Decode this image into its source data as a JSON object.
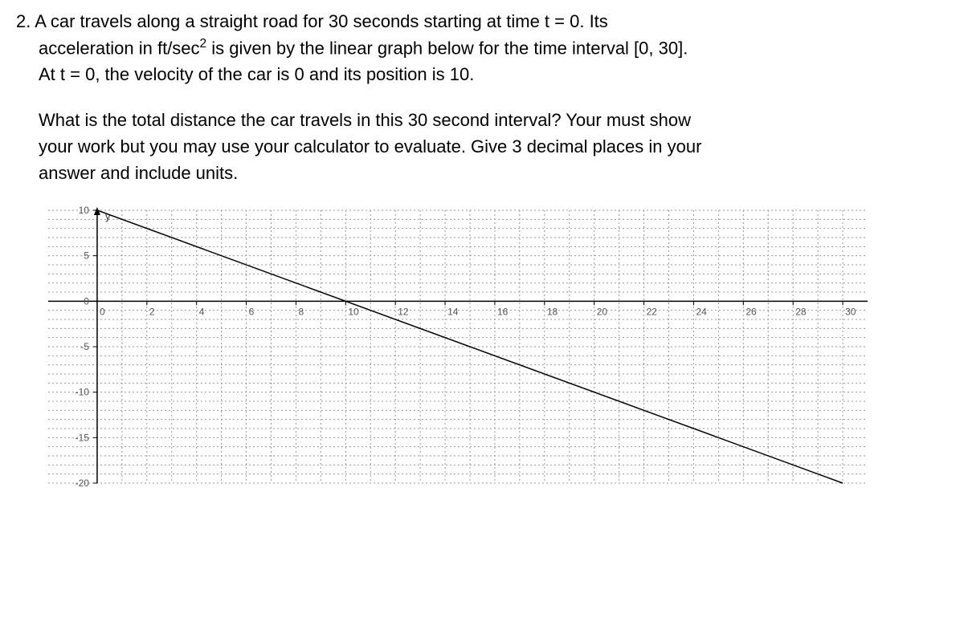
{
  "problem": {
    "number": "2.",
    "text_line1": "A car travels along a straight road for 30 seconds starting at time t = 0. Its",
    "text_line2_pre": "acceleration in ft/sec",
    "text_line2_sup": "2",
    "text_line2_post": " is given by the linear graph below for the time interval [0, 30].",
    "text_line3": "At t = 0, the velocity of the car is 0 and its position is 10.",
    "question_line1": "What is the total distance the car travels in this 30 second interval? Your must show",
    "question_line2": "your work but you may use your calculator to evaluate. Give 3 decimal places in your",
    "question_line3": "answer and include units."
  },
  "chart_data": {
    "type": "line",
    "title": "",
    "xlabel": "",
    "ylabel": "y",
    "xlim": [
      -1,
      31
    ],
    "ylim": [
      -20,
      10
    ],
    "x_ticks": [
      0,
      2,
      4,
      6,
      8,
      10,
      12,
      14,
      16,
      18,
      20,
      22,
      24,
      26,
      28,
      30
    ],
    "y_ticks": [
      -20,
      -15,
      -10,
      -5,
      0,
      5,
      10
    ],
    "x_tick_labels": [
      "0",
      "2",
      "4",
      "6",
      "8",
      "10",
      "12",
      "14",
      "16",
      "18",
      "20",
      "22",
      "24",
      "26",
      "28",
      "30"
    ],
    "y_tick_labels": [
      "-20",
      "-15",
      "-10",
      "-5",
      "0",
      "5",
      "10"
    ],
    "series": [
      {
        "name": "acceleration",
        "x": [
          0,
          30
        ],
        "y": [
          10,
          -20
        ]
      }
    ],
    "grid": true
  }
}
